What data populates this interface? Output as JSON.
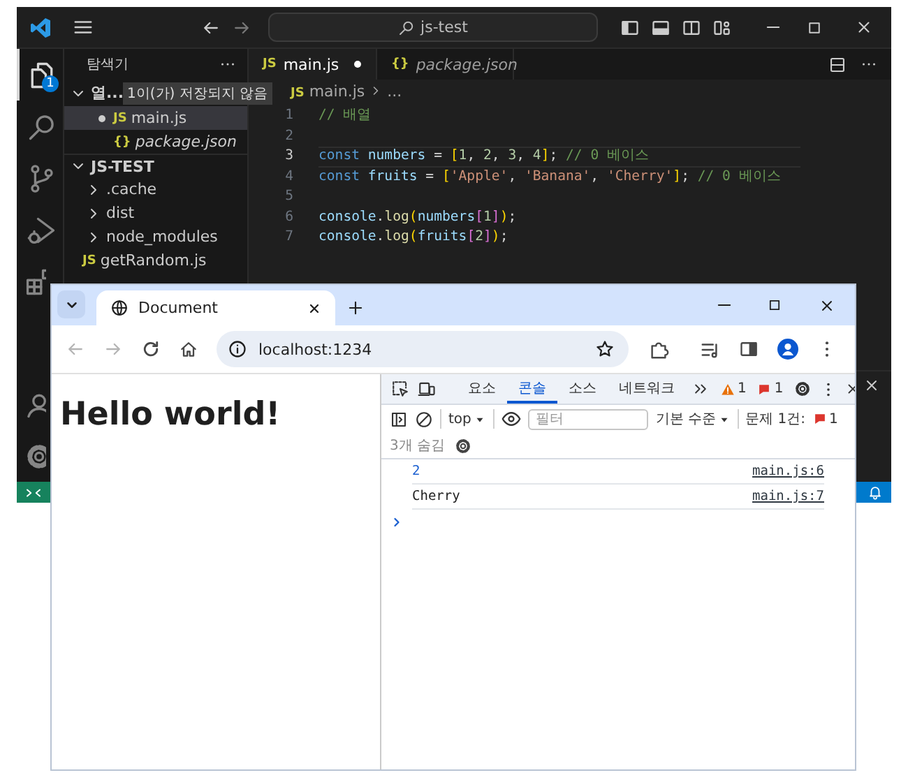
{
  "vscode": {
    "title": "js-test",
    "activity_bar": [
      {
        "kind": "explorer",
        "selected": true,
        "badge": "1"
      },
      {
        "kind": "search",
        "selected": false
      },
      {
        "kind": "source-control",
        "selected": false
      },
      {
        "kind": "run",
        "selected": false
      },
      {
        "kind": "extensions",
        "selected": false
      }
    ],
    "activity_bottom": [
      {
        "kind": "account"
      },
      {
        "kind": "manage"
      }
    ],
    "sidebar": {
      "title": "탐색기",
      "open_editors": {
        "label": "열...",
        "expanded": true,
        "notice": "1이(가) 저장되지 않음",
        "files": [
          {
            "name": "main.js",
            "icon": "JS",
            "modified": true,
            "selected": true,
            "preview": false
          },
          {
            "name": "package.json",
            "icon": "{}",
            "modified": false,
            "selected": false,
            "preview": true
          }
        ]
      },
      "folder": {
        "label": "JS-TEST",
        "expanded": true,
        "children": [
          {
            "kind": "folder",
            "name": ".cache",
            "expanded": false
          },
          {
            "kind": "folder",
            "name": "dist",
            "expanded": false
          },
          {
            "kind": "folder",
            "name": "node_modules",
            "expanded": false
          },
          {
            "kind": "file",
            "name": "getRandom.js",
            "icon": "JS"
          }
        ]
      }
    },
    "tabs": [
      {
        "name": "main.js",
        "icon": "JS",
        "selected": true,
        "modified": true,
        "preview": false
      },
      {
        "name": "package.json",
        "icon": "{}",
        "selected": false,
        "modified": false,
        "preview": true
      }
    ],
    "breadcrumb": [
      {
        "icon": "JS",
        "label": "main.js"
      },
      {
        "label": "..."
      }
    ],
    "lines": [
      {
        "number": "1",
        "current": false,
        "tokens": [
          {
            "kind": "comment",
            "text": "// 배열"
          }
        ]
      },
      {
        "number": "2",
        "current": false
      },
      {
        "number": "3",
        "current": true,
        "tokens": [
          {
            "kind": "keyword",
            "text": "const "
          },
          {
            "kind": "variable",
            "text": "numbers"
          },
          {
            "kind": "plain",
            "text": " = "
          },
          {
            "kind": "bracket1",
            "text": "["
          },
          {
            "kind": "number",
            "text": "1"
          },
          {
            "kind": "plain",
            "text": ", "
          },
          {
            "kind": "number",
            "text": "2"
          },
          {
            "kind": "plain",
            "text": ", "
          },
          {
            "kind": "number",
            "text": "3"
          },
          {
            "kind": "plain",
            "text": ", "
          },
          {
            "kind": "number",
            "text": "4"
          },
          {
            "kind": "bracket1",
            "text": "]"
          },
          {
            "kind": "plain",
            "text": "; "
          },
          {
            "kind": "comment",
            "text": "// 0 베이스"
          }
        ]
      },
      {
        "number": "4",
        "current": false,
        "tokens": [
          {
            "kind": "keyword",
            "text": "const "
          },
          {
            "kind": "variable",
            "text": "fruits"
          },
          {
            "kind": "plain",
            "text": " = "
          },
          {
            "kind": "bracket1",
            "text": "["
          },
          {
            "kind": "string",
            "text": "'Apple'"
          },
          {
            "kind": "plain",
            "text": ", "
          },
          {
            "kind": "string",
            "text": "'Banana'"
          },
          {
            "kind": "plain",
            "text": ", "
          },
          {
            "kind": "string",
            "text": "'Cherry'"
          },
          {
            "kind": "bracket1",
            "text": "]"
          },
          {
            "kind": "plain",
            "text": "; "
          },
          {
            "kind": "comment",
            "text": "// 0 베이스"
          }
        ]
      },
      {
        "number": "5",
        "current": false
      },
      {
        "number": "6",
        "current": false,
        "tokens": [
          {
            "kind": "variable",
            "text": "console"
          },
          {
            "kind": "plain",
            "text": "."
          },
          {
            "kind": "function",
            "text": "log"
          },
          {
            "kind": "bracket1",
            "text": "("
          },
          {
            "kind": "variable",
            "text": "numbers"
          },
          {
            "kind": "bracket2",
            "text": "["
          },
          {
            "kind": "number",
            "text": "1"
          },
          {
            "kind": "bracket2",
            "text": "]"
          },
          {
            "kind": "bracket1",
            "text": ")"
          },
          {
            "kind": "plain",
            "text": ";"
          }
        ]
      },
      {
        "number": "7",
        "current": false,
        "tokens": [
          {
            "kind": "variable",
            "text": "console"
          },
          {
            "kind": "plain",
            "text": "."
          },
          {
            "kind": "function",
            "text": "log"
          },
          {
            "kind": "bracket1",
            "text": "("
          },
          {
            "kind": "variable",
            "text": "fruits"
          },
          {
            "kind": "bracket2",
            "text": "["
          },
          {
            "kind": "number",
            "text": "2"
          },
          {
            "kind": "bracket2",
            "text": "]"
          },
          {
            "kind": "bracket1",
            "text": ")"
          },
          {
            "kind": "plain",
            "text": ";"
          }
        ]
      }
    ]
  },
  "browser": {
    "tabs": [
      {
        "title": "Document",
        "selected": true
      }
    ],
    "back": {
      "disabled": true
    },
    "forward": {
      "disabled": true
    },
    "url": "localhost:1234",
    "page": {
      "heading": "Hello world!"
    },
    "devtools": {
      "tabs": [
        {
          "label": "요소",
          "selected": false
        },
        {
          "label": "콘솔",
          "selected": true
        },
        {
          "label": "소스",
          "selected": false
        },
        {
          "label": "네트워크",
          "selected": false
        }
      ],
      "warnings": "1",
      "errors": "1",
      "context": "top",
      "filter": {
        "placeholder": "필터"
      },
      "levels": "기본 수준",
      "issues": {
        "label": "문제 1건:",
        "count": "1"
      },
      "hidden": "3개 숨김",
      "messages": [
        {
          "kind": "number",
          "text": "2",
          "source": "main.js:6"
        },
        {
          "kind": "string",
          "text": "Cherry",
          "source": "main.js:7"
        }
      ]
    }
  }
}
